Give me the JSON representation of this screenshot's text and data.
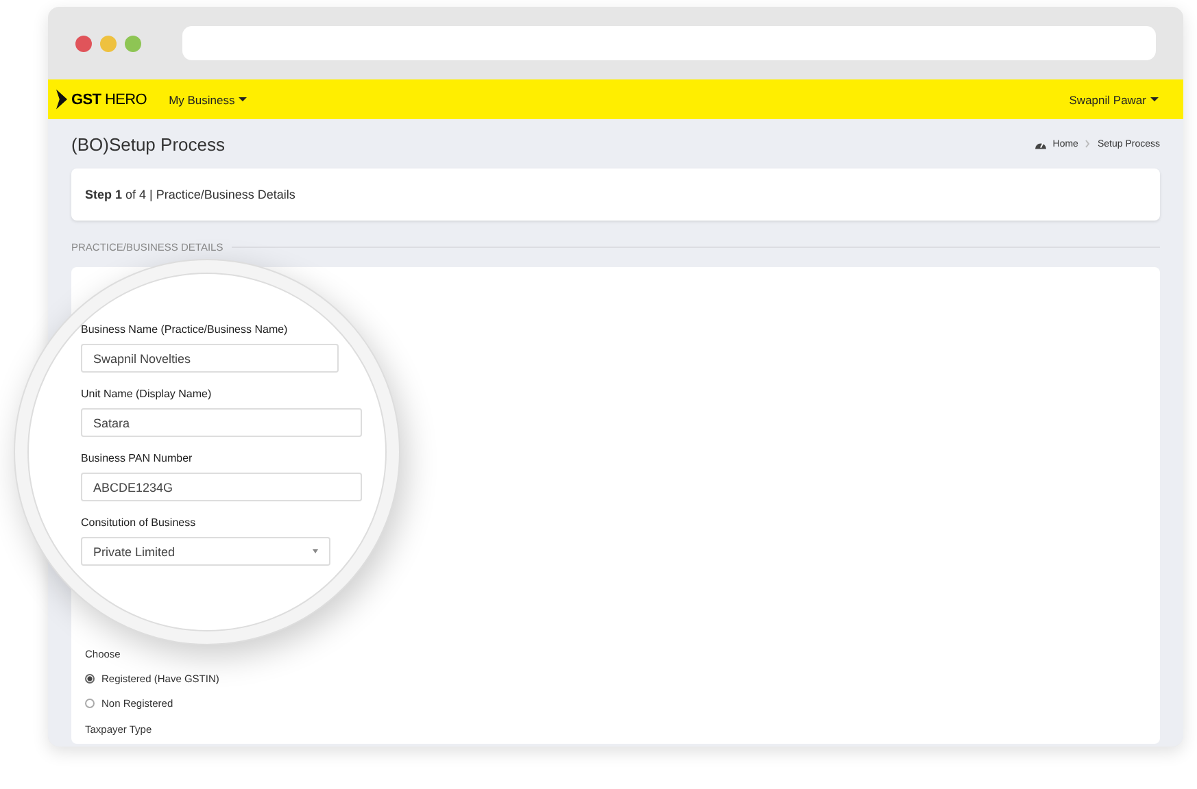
{
  "app": {
    "logo": "**GST** HERO",
    "nav": [
      {
        "label": "My Business"
      }
    ],
    "user": "Swapnil Pawar"
  },
  "page_title": "(BO)Setup Process",
  "breadcrumb": [
    "Home",
    "Setup Process"
  ],
  "step": "**Step 1** of 4 | Practice/Business Details",
  "section_title": "PRACTICE/BUSINESS DETAILS",
  "magnified_fields": [
    {
      "kind": "text",
      "label": "Business Name (Practice/Business Name)",
      "value": "Swapnil Novelties"
    },
    {
      "kind": "text",
      "label": "Unit Name (Display Name)",
      "value": "Satara"
    },
    {
      "kind": "text",
      "label": "Business PAN Number",
      "value": "ABCDE1234G"
    },
    {
      "kind": "select",
      "label": "Consitution of Business",
      "value": "Private Limited"
    }
  ],
  "choose_label": "Choose",
  "registration_options": [
    {
      "label": "Registered (Have GSTIN)",
      "selected": true
    },
    {
      "label": "Non Registered",
      "selected": false
    }
  ],
  "next_label": "Taxpayer Type"
}
